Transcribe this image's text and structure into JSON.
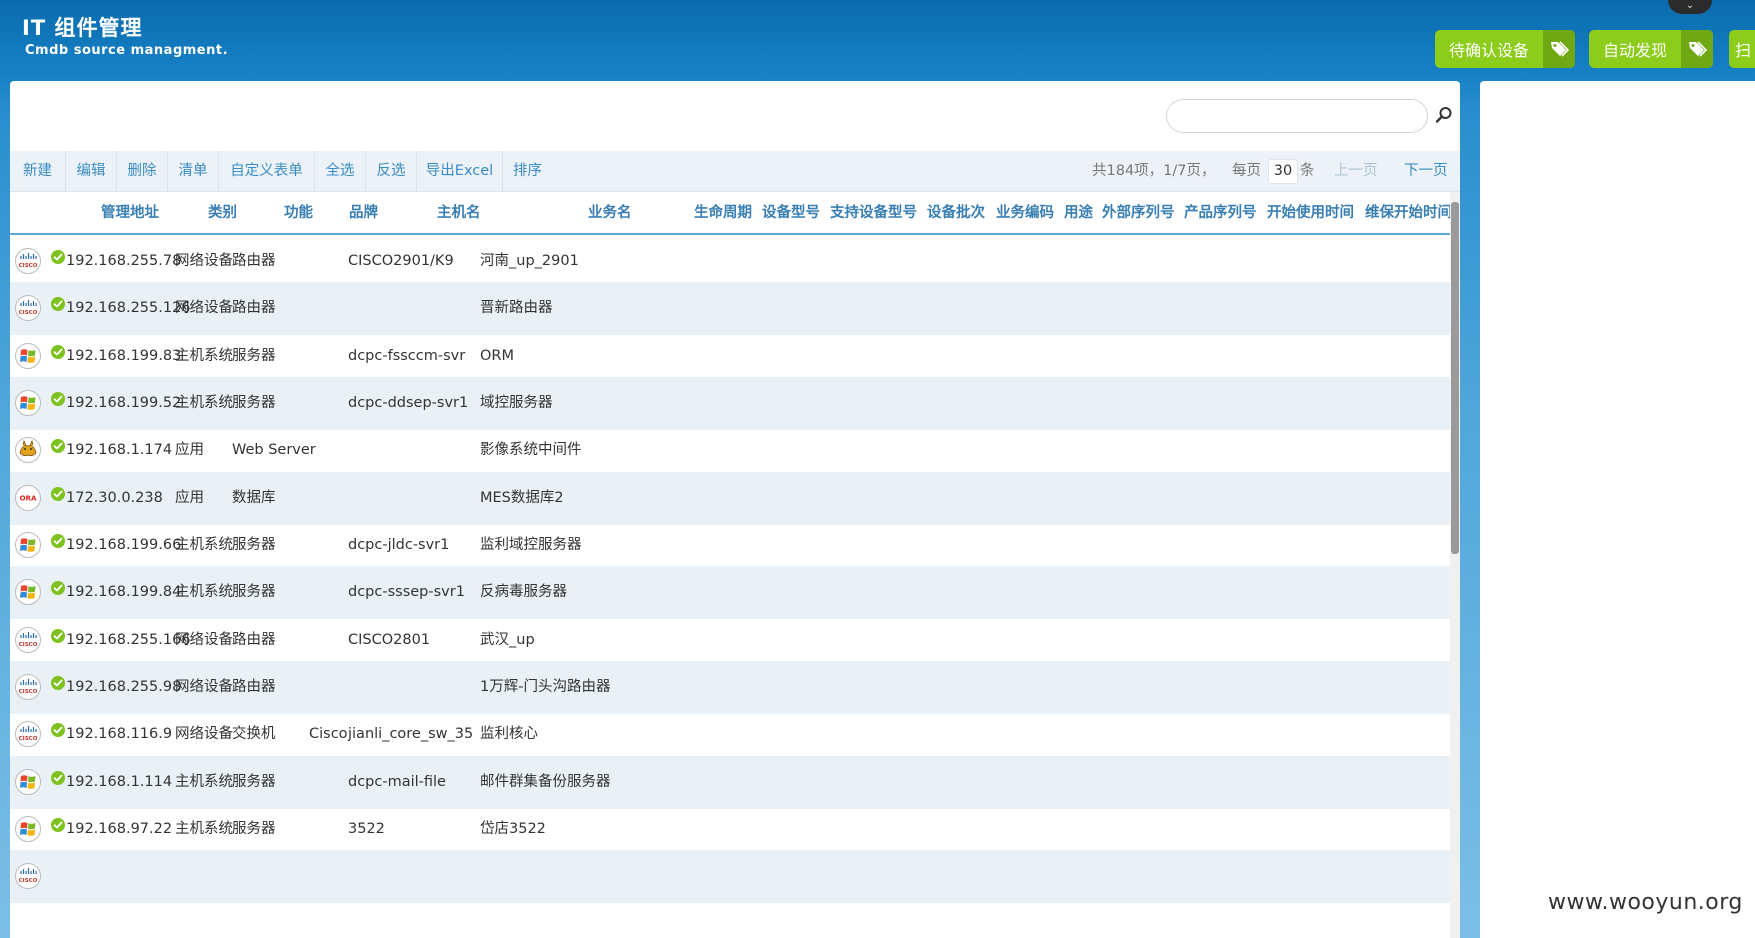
{
  "header": {
    "title": "IT 组件管理",
    "subtitle": "Cmdb source managment.",
    "collapse_glyph": "⌄",
    "buttons": [
      {
        "label": "待确认设备",
        "icon": "tag-icon"
      },
      {
        "label": "自动发现",
        "icon": "tag-icon"
      },
      {
        "label": "扫",
        "icon": "tag-icon"
      }
    ]
  },
  "search": {
    "value": "",
    "placeholder": "",
    "icon": "search-icon"
  },
  "toolbar": {
    "buttons": [
      "新建",
      "编辑",
      "删除",
      "清单",
      "自定义表单",
      "全选",
      "反选",
      "导出Excel",
      "排序"
    ]
  },
  "pager": {
    "total": "共184项，1/7页，",
    "per_page_label": "每页",
    "per_page": "30",
    "unit": "条",
    "prev": "上一页",
    "next": "下一页"
  },
  "table": {
    "columns": [
      "管理地址",
      "类别",
      "功能",
      "品牌",
      "主机名",
      "业务名",
      "生命周期",
      "设备型号",
      "支持设备型号",
      "设备批次",
      "业务编码",
      "用途",
      "外部序列号",
      "产品序列号",
      "开始使用时间",
      "维保开始时间"
    ],
    "rows": [
      {
        "icon": "cisco",
        "ip": "192.168.255.78",
        "category": "网络设备",
        "function": "路由器",
        "brand": "",
        "hostname": "CISCO2901/K9",
        "business": "河南_up_2901"
      },
      {
        "icon": "cisco",
        "ip": "192.168.255.126",
        "category": "网络设备",
        "function": "路由器",
        "brand": "",
        "hostname": "",
        "business": "晋新路由器"
      },
      {
        "icon": "windows",
        "ip": "192.168.199.83",
        "category": "主机系统",
        "function": "服务器",
        "brand": "",
        "hostname": "dcpc-fssccm-svr",
        "business": "ORM"
      },
      {
        "icon": "windows",
        "ip": "192.168.199.52",
        "category": "主机系统",
        "function": "服务器",
        "brand": "",
        "hostname": "dcpc-ddsep-svr1",
        "business": "域控服务器"
      },
      {
        "icon": "tomcat",
        "ip": "192.168.1.174",
        "category": "应用",
        "function": "Web Server",
        "brand": "",
        "hostname": "",
        "business": "影像系统中间件"
      },
      {
        "icon": "oracle",
        "ip": "172.30.0.238",
        "category": "应用",
        "function": "数据库",
        "brand": "",
        "hostname": "",
        "business": "MES数据库2"
      },
      {
        "icon": "windows",
        "ip": "192.168.199.66",
        "category": "主机系统",
        "function": "服务器",
        "brand": "",
        "hostname": "dcpc-jldc-svr1",
        "business": "监利域控服务器"
      },
      {
        "icon": "windows",
        "ip": "192.168.199.84",
        "category": "主机系统",
        "function": "服务器",
        "brand": "",
        "hostname": "dcpc-sssep-svr1",
        "business": "反病毒服务器"
      },
      {
        "icon": "cisco",
        "ip": "192.168.255.166",
        "category": "网络设备",
        "function": "路由器",
        "brand": "",
        "hostname": "CISCO2801",
        "business": "武汉_up"
      },
      {
        "icon": "cisco",
        "ip": "192.168.255.98",
        "category": "网络设备",
        "function": "路由器",
        "brand": "",
        "hostname": "",
        "business": "1万辉-门头沟路由器"
      },
      {
        "icon": "cisco",
        "ip": "192.168.116.9",
        "category": "网络设备",
        "function": "交换机",
        "brand": "Cisco",
        "hostname": "jianli_core_sw_35",
        "business": "监利核心"
      },
      {
        "icon": "windows",
        "ip": "192.168.1.114",
        "category": "主机系统",
        "function": "服务器",
        "brand": "",
        "hostname": "dcpc-mail-file",
        "business": "邮件群集备份服务器"
      },
      {
        "icon": "windows",
        "ip": "192.168.97.22",
        "category": "主机系统",
        "function": "服务器",
        "brand": "",
        "hostname": "3522",
        "business": "岱店3522"
      },
      {
        "icon": "cisco",
        "ip": "",
        "category": "",
        "function": "",
        "brand": "",
        "hostname": "",
        "business": ""
      }
    ]
  },
  "watermark": "www.wooyun.org",
  "colors": {
    "header_bg": "#0a6cae",
    "button_green": "#8ccc1a",
    "link_blue": "#3b8dc7",
    "header_text": "#3a7fb4",
    "row_alt": "#e9f0f6",
    "ok_green": "#7dc21e"
  }
}
